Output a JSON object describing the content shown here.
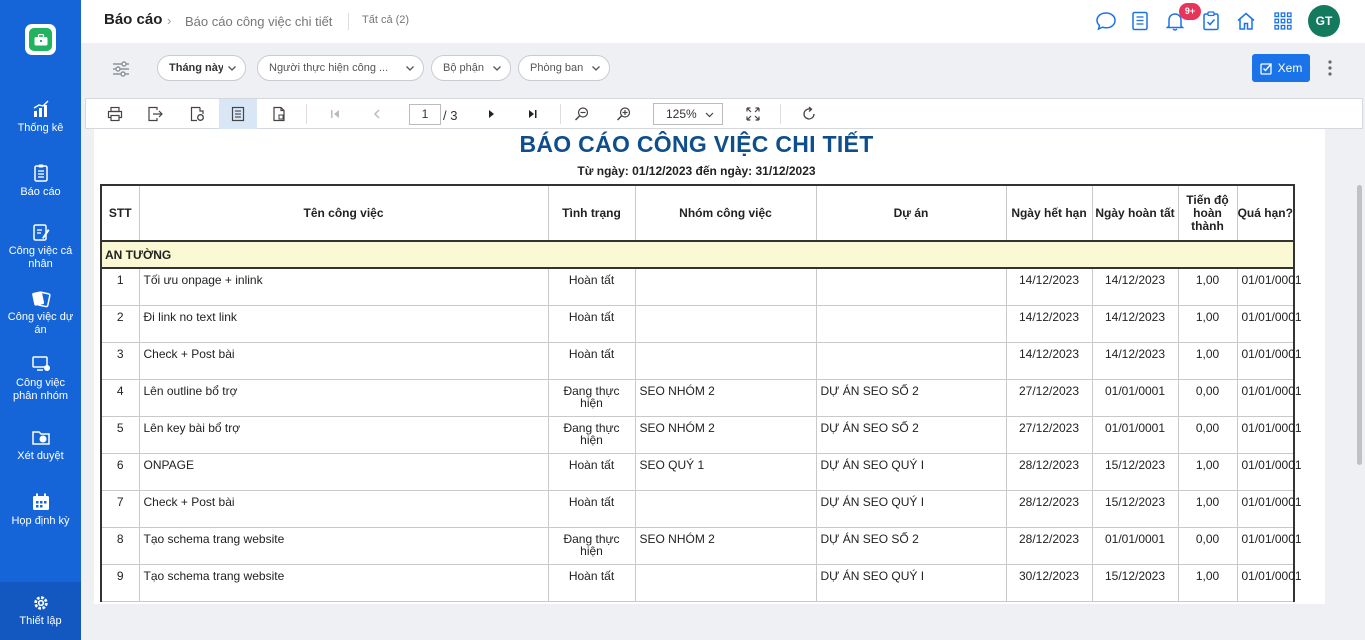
{
  "sidebar": {
    "items": [
      {
        "label": "Thống kê"
      },
      {
        "label": "Báo cáo"
      },
      {
        "label": "Công việc cá nhân"
      },
      {
        "label": "Công việc dự án"
      },
      {
        "label": "Công việc phân nhóm"
      },
      {
        "label": "Xét duyệt"
      },
      {
        "label": "Họp định kỳ"
      }
    ],
    "settings_label": "Thiết lập"
  },
  "header": {
    "breadcrumb_root": "Báo cáo",
    "breadcrumb_current": "Báo cáo công việc chi tiết",
    "count": "Tất cả (2)",
    "notification_badge": "9+",
    "avatar_initials": "GT"
  },
  "filters": {
    "month": "Tháng này",
    "assignee": "Người thực hiện công ...",
    "division": "Bộ phận",
    "department": "Phòng ban",
    "view_button": "Xem"
  },
  "viewer": {
    "page_current": "1",
    "page_total": "/ 3",
    "zoom": "125%"
  },
  "report": {
    "title": "BÁO CÁO CÔNG VIỆC CHI TIẾT",
    "date_range": "Từ ngày: 01/12/2023 đến ngày: 31/12/2023",
    "headers": {
      "stt": "STT",
      "name": "Tên công việc",
      "status": "Tình trạng",
      "group": "Nhóm công việc",
      "project": "Dự án",
      "deadline": "Ngày hết hạn",
      "completed": "Ngày hoàn tất",
      "progress": "Tiến độ hoàn thành",
      "overdue": "Quá hạn?"
    },
    "group_name": "AN TƯỜNG",
    "rows": [
      {
        "stt": "1",
        "name": "Tối ưu onpage + inlink",
        "status": "Hoàn tất",
        "group": "",
        "project": "",
        "deadline": "14/12/2023",
        "completed": "14/12/2023",
        "progress": "1,00",
        "overdue": "01/01/0001"
      },
      {
        "stt": "2",
        "name": "Đi link no text link",
        "status": "Hoàn tất",
        "group": "",
        "project": "",
        "deadline": "14/12/2023",
        "completed": "14/12/2023",
        "progress": "1,00",
        "overdue": "01/01/0001"
      },
      {
        "stt": "3",
        "name": "Check + Post bài",
        "status": "Hoàn tất",
        "group": "",
        "project": "",
        "deadline": "14/12/2023",
        "completed": "14/12/2023",
        "progress": "1,00",
        "overdue": "01/01/0001"
      },
      {
        "stt": "4",
        "name": "Lên outline bổ trợ",
        "status": "Đang thực hiện",
        "group": "SEO NHÓM 2",
        "project": "DỰ ÁN SEO SỐ 2",
        "deadline": "27/12/2023",
        "completed": "01/01/0001",
        "progress": "0,00",
        "overdue": "01/01/0001"
      },
      {
        "stt": "5",
        "name": "Lên key bài bổ trợ",
        "status": "Đang thực hiện",
        "group": "SEO NHÓM 2",
        "project": "DỰ ÁN SEO SỐ 2",
        "deadline": "27/12/2023",
        "completed": "01/01/0001",
        "progress": "0,00",
        "overdue": "01/01/0001"
      },
      {
        "stt": "6",
        "name": "ONPAGE",
        "status": "Hoàn tất",
        "group": "SEO QUÝ 1",
        "project": "DỰ ÁN SEO QUÝ I",
        "deadline": "28/12/2023",
        "completed": "15/12/2023",
        "progress": "1,00",
        "overdue": "01/01/0001"
      },
      {
        "stt": "7",
        "name": "Check + Post bài",
        "status": "Hoàn tất",
        "group": "",
        "project": "DỰ ÁN SEO QUÝ I",
        "deadline": "28/12/2023",
        "completed": "15/12/2023",
        "progress": "1,00",
        "overdue": "01/01/0001"
      },
      {
        "stt": "8",
        "name": "Tạo schema trang website",
        "status": "Đang thực hiện",
        "group": "SEO NHÓM 2",
        "project": "DỰ ÁN SEO SỐ 2",
        "deadline": "28/12/2023",
        "completed": "01/01/0001",
        "progress": "0,00",
        "overdue": "01/01/0001"
      },
      {
        "stt": "9",
        "name": "Tạo schema trang website",
        "status": "Hoàn tất",
        "group": "",
        "project": "DỰ ÁN SEO QUÝ I",
        "deadline": "30/12/2023",
        "completed": "15/12/2023",
        "progress": "1,00",
        "overdue": "01/01/0001"
      }
    ]
  }
}
